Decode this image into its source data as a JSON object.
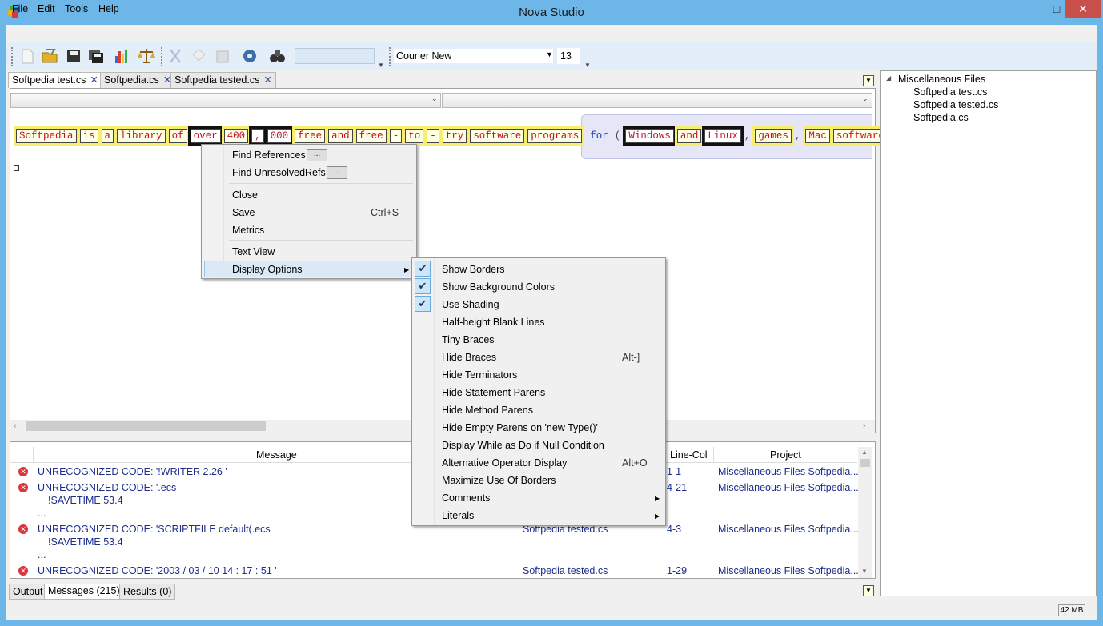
{
  "window": {
    "title": "Nova Studio"
  },
  "menu": [
    "File",
    "Edit",
    "Tools",
    "Help"
  ],
  "toolbar": {
    "font_name": "Courier New",
    "font_size": "13",
    "icons": [
      "new-file-icon",
      "open-folder-icon",
      "save-icon",
      "save-all-icon",
      "chart-icon",
      "balance-scale-icon",
      "cut-icon",
      "copy-icon",
      "paste-icon",
      "settings-gear-icon",
      "binoculars-icon"
    ]
  },
  "tabs": [
    "Softpedia test.cs",
    "Softpedia.cs",
    "Softpedia tested.cs"
  ],
  "code_tokens": [
    "Softpedia",
    "is",
    "a",
    "library",
    "of",
    "over",
    "400",
    ",",
    "000",
    "free",
    "and",
    "free",
    "-",
    "to",
    "-",
    "try",
    "software",
    "programs"
  ],
  "code_tail": {
    "kw": "for",
    "open": "(",
    "tokens": [
      "Windows",
      "and",
      "Linux"
    ],
    "comma1": ",",
    "t2": "games",
    "comma2": ",",
    "t3": "Mac",
    "t4": "software"
  },
  "context_menu": {
    "find_references": "Find References",
    "find_unresolved": "Find UnresolvedRefs",
    "ellipsis": "...",
    "close": "Close",
    "save": "Save",
    "save_shortcut": "Ctrl+S",
    "metrics": "Metrics",
    "text_view": "Text View",
    "display_options": "Display Options"
  },
  "display_options": [
    {
      "label": "Show Borders",
      "checked": true,
      "shortcut": ""
    },
    {
      "label": "Show Background Colors",
      "checked": true,
      "shortcut": ""
    },
    {
      "label": "Use Shading",
      "checked": true,
      "shortcut": ""
    },
    {
      "label": "Half-height Blank Lines",
      "checked": false,
      "shortcut": ""
    },
    {
      "label": "Tiny Braces",
      "checked": false,
      "shortcut": ""
    },
    {
      "label": "Hide Braces",
      "checked": false,
      "shortcut": "Alt-]"
    },
    {
      "label": "Hide Terminators",
      "checked": false,
      "shortcut": ""
    },
    {
      "label": "Hide Statement Parens",
      "checked": false,
      "shortcut": ""
    },
    {
      "label": "Hide Method Parens",
      "checked": false,
      "shortcut": ""
    },
    {
      "label": "Hide Empty Parens on 'new Type()'",
      "checked": false,
      "shortcut": ""
    },
    {
      "label": "Display While as Do if Null Condition",
      "checked": false,
      "shortcut": ""
    },
    {
      "label": "Alternative Operator Display",
      "checked": false,
      "shortcut": "Alt+O"
    },
    {
      "label": "Maximize Use Of Borders",
      "checked": false,
      "shortcut": ""
    },
    {
      "label": "Comments",
      "checked": false,
      "shortcut": "",
      "submenu": true
    },
    {
      "label": "Literals",
      "checked": false,
      "shortcut": "",
      "submenu": true
    }
  ],
  "messages": {
    "columns": {
      "message": "Message",
      "line_col": "Line-Col",
      "project": "Project"
    },
    "rows": [
      {
        "msg": "UNRECOGNIZED CODE: '!WRITER 2.26 '",
        "sub": [],
        "file": "",
        "line": "1-1",
        "project": "Miscellaneous Files Softpedia..."
      },
      {
        "msg": "UNRECOGNIZED CODE: '.ecs",
        "sub": [
          "!SAVETIME 53.4",
          "..."
        ],
        "file": "",
        "line": "4-21",
        "project": "Miscellaneous Files Softpedia..."
      },
      {
        "msg": "UNRECOGNIZED CODE: 'SCRIPTFILE default(.ecs",
        "sub": [
          "!SAVETIME 53.4",
          "..."
        ],
        "file": "Softpedia tested.cs",
        "line": "4-3",
        "project": "Miscellaneous Files Softpedia..."
      },
      {
        "msg": "UNRECOGNIZED CODE: '2003 / 03 / 10 14 : 17 : 51 '",
        "sub": [],
        "file": "Softpedia tested.cs",
        "line": "1-29",
        "project": "Miscellaneous Files Softpedia..."
      }
    ]
  },
  "bottom_tabs": [
    "Output",
    "Messages (215)",
    "Results (0)"
  ],
  "tree": {
    "root": "Miscellaneous Files",
    "children": [
      "Softpedia test.cs",
      "Softpedia tested.cs",
      "Softpedia.cs"
    ]
  },
  "status": {
    "memory": "42 MB"
  }
}
